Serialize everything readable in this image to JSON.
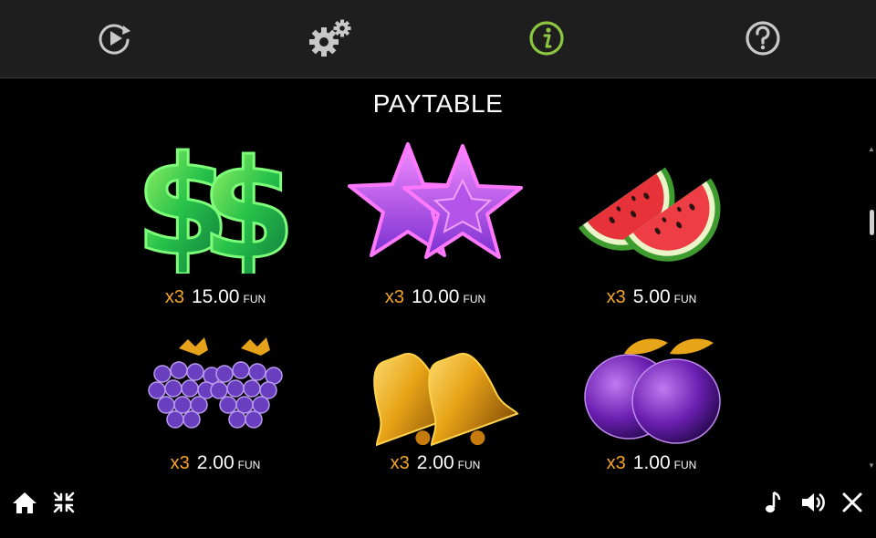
{
  "toolbar": {
    "icons": [
      "autoplay-icon",
      "settings-icon",
      "info-icon",
      "help-icon"
    ],
    "active": "info-icon",
    "active_color": "#8dc63f",
    "icon_color": "#c8c8c8"
  },
  "paytable": {
    "title": "PAYTABLE",
    "entries": [
      {
        "symbol": "double-dollar",
        "multiplier": "x3",
        "amount": "15.00",
        "unit": "FUN"
      },
      {
        "symbol": "double-star",
        "multiplier": "x3",
        "amount": "10.00",
        "unit": "FUN"
      },
      {
        "symbol": "watermelon",
        "multiplier": "x3",
        "amount": "5.00",
        "unit": "FUN"
      },
      {
        "symbol": "grapes",
        "multiplier": "x3",
        "amount": "2.00",
        "unit": "FUN"
      },
      {
        "symbol": "bells",
        "multiplier": "x3",
        "amount": "2.00",
        "unit": "FUN"
      },
      {
        "symbol": "plums",
        "multiplier": "x3",
        "amount": "1.00",
        "unit": "FUN"
      }
    ]
  },
  "bottombar": {
    "left_icons": [
      "home-icon",
      "minimize-icon"
    ],
    "right_icons": [
      "music-icon",
      "sound-icon",
      "close-icon"
    ]
  },
  "colors": {
    "multiplier": "#f5a623",
    "background": "#000000",
    "toolbar_bg": "#1e1e1e"
  }
}
